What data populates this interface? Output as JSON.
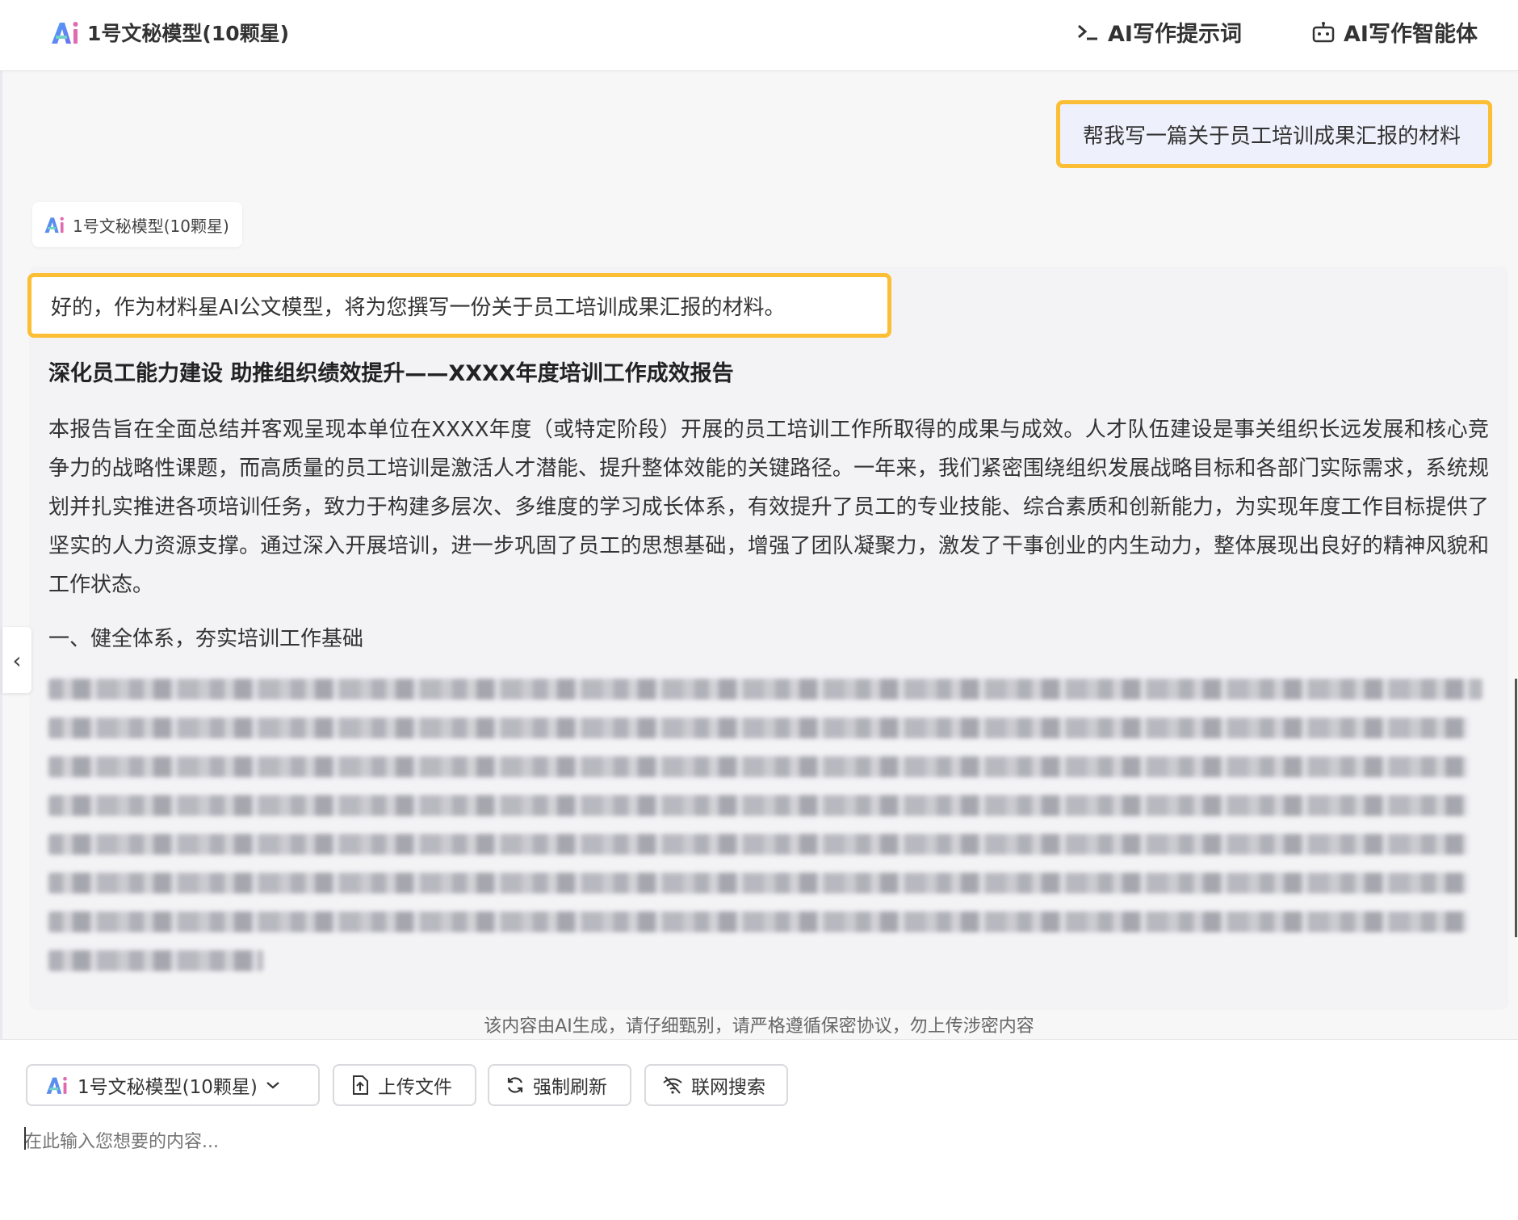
{
  "header": {
    "app_title": "1号文秘模型(10颗星)",
    "prompt_link": "AI写作提示词",
    "agent_link": "AI写作智能体"
  },
  "chat": {
    "user_message": "帮我写一篇关于员工培训成果汇报的材料",
    "model_tag": "1号文秘模型(10颗星)",
    "reply_intro": "好的，作为材料星AI公文模型，将为您撰写一份关于员工培训成果汇报的材料。",
    "report_title": "深化员工能力建设 助推组织绩效提升——XXXX年度培训工作成效报告",
    "paragraph": "本报告旨在全面总结并客观呈现本单位在XXXX年度（或特定阶段）开展的员工培训工作所取得的成果与成效。人才队伍建设是事关组织长远发展和核心竞争力的战略性课题，而高质量的员工培训是激活人才潜能、提升整体效能的关键路径。一年来，我们紧密围绕组织发展战略目标和各部门实际需求，系统规划并扎实推进各项培训任务，致力于构建多层次、多维度的学习成长体系，有效提升了员工的专业技能、综合素质和创新能力，为实现年度工作目标提供了坚实的人力资源支撑。通过深入开展培训，进一步巩固了员工的思想基础，增强了团队凝聚力，激发了干事创业的内生动力，整体展现出良好的精神风貌和工作状态。",
    "section_heading": "一、健全体系，夯实培训工作基础"
  },
  "disclaimer": "该内容由AI生成，请仔细甄别，请严格遵循保密协议，勿上传涉密内容",
  "toolbar": {
    "model_select": "1号文秘模型(10颗星)",
    "upload": "上传文件",
    "refresh": "强制刷新",
    "web_search": "联网搜索"
  },
  "input": {
    "placeholder": "在此输入您想要的内容..."
  },
  "colors": {
    "highlight": "#fbbe34",
    "user_bubble": "#eef0fb",
    "logo_a": "#5b8def",
    "logo_i": "#e06bb0"
  }
}
